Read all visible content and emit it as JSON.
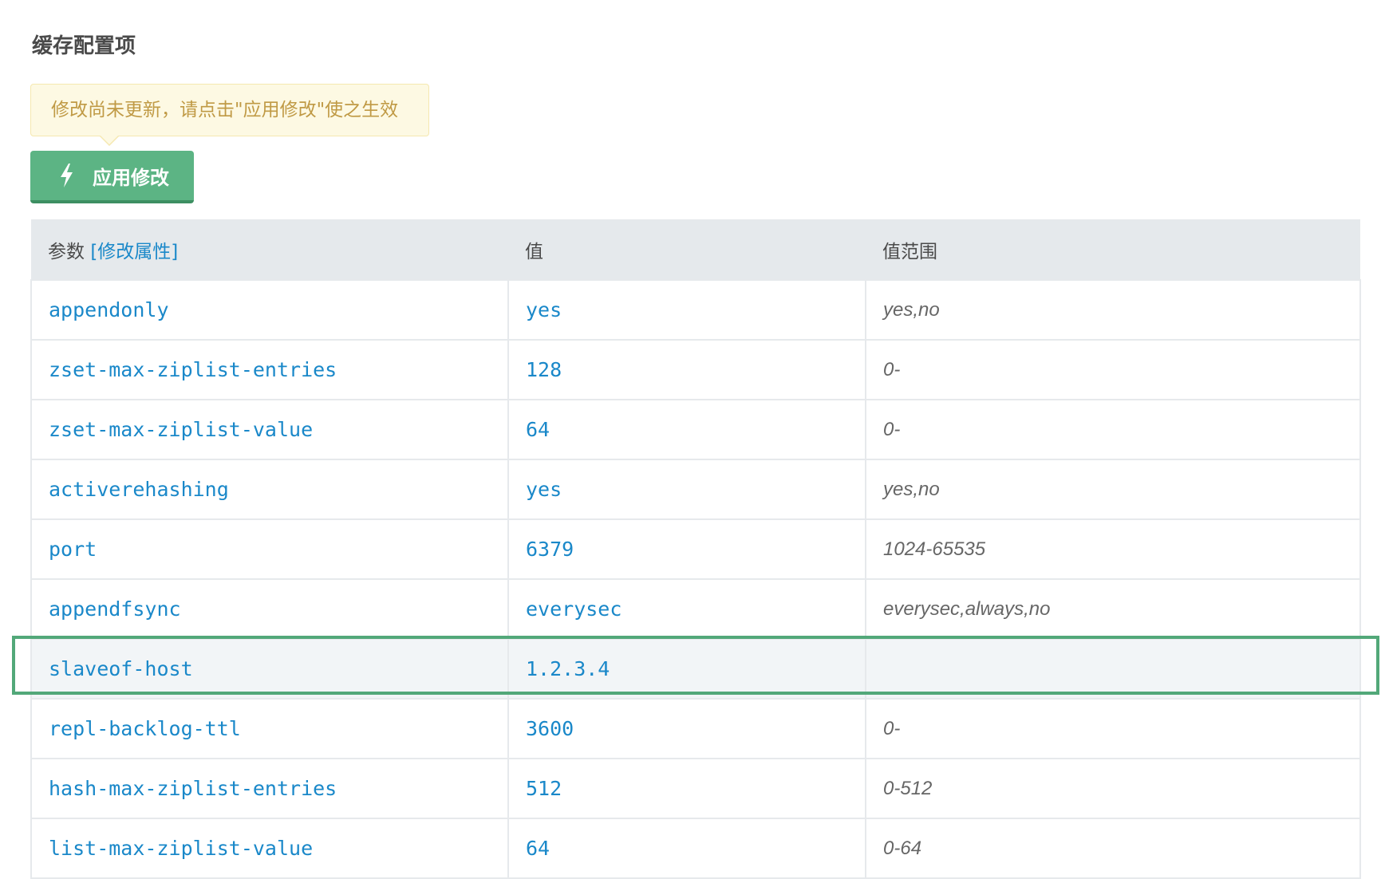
{
  "page_title": "缓存配置项",
  "notice": "修改尚未更新，请点击\"应用修改\"使之生效",
  "apply_button": {
    "icon": "lightning-bolt-icon",
    "label": "应用修改"
  },
  "table": {
    "headers": {
      "param": "参数",
      "edit_link": "[修改属性]",
      "value": "值",
      "range": "值范围"
    },
    "rows": [
      {
        "param": "appendonly",
        "value": "yes",
        "range": "yes,no"
      },
      {
        "param": "zset-max-ziplist-entries",
        "value": "128",
        "range": "0-"
      },
      {
        "param": "zset-max-ziplist-value",
        "value": "64",
        "range": "0-"
      },
      {
        "param": "activerehashing",
        "value": "yes",
        "range": "yes,no"
      },
      {
        "param": "port",
        "value": "6379",
        "range": "1024-65535"
      },
      {
        "param": "appendfsync",
        "value": "everysec",
        "range": "everysec,always,no"
      },
      {
        "param": "slaveof-host",
        "value": "1.2.3.4",
        "range": ""
      },
      {
        "param": "repl-backlog-ttl",
        "value": "3600",
        "range": "0-"
      },
      {
        "param": "hash-max-ziplist-entries",
        "value": "512",
        "range": "0-512"
      },
      {
        "param": "list-max-ziplist-value",
        "value": "64",
        "range": "0-64"
      }
    ]
  },
  "colors": {
    "accent_link": "#1a88c9",
    "button_green": "#5cb484",
    "highlight_frame": "#52a879",
    "notice_bg": "#fdf9e3",
    "notice_text": "#c09a45"
  }
}
